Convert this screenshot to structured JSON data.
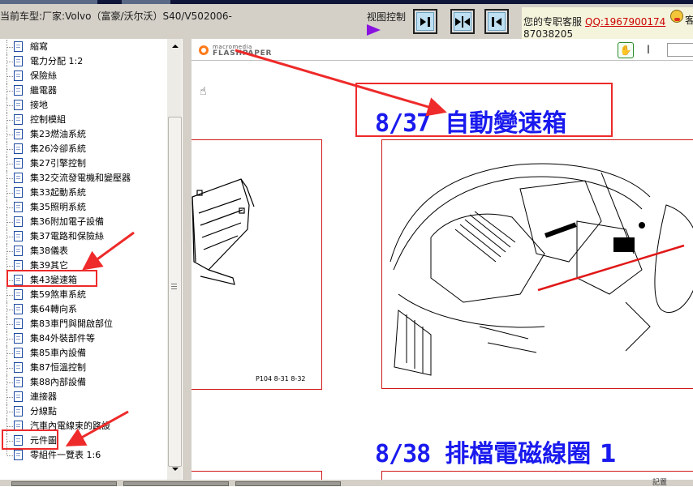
{
  "header": {
    "vehicle_prefix": "当前车型:",
    "vehicle_info": "厂家:Volvo（富豪/沃尔沃）S40/V502006-",
    "view_control_label": "视图控制",
    "support_text": "您的专职客服",
    "support_qq": "QQ:1967900174",
    "support_phone": "87038205",
    "support_tail": "客",
    "buttons": [
      {
        "name": "first-page-icon"
      },
      {
        "name": "split-view-icon"
      },
      {
        "name": "prev-page-icon"
      }
    ]
  },
  "tree": {
    "items": [
      {
        "label": "縮寫"
      },
      {
        "label": "電力分配 1:2"
      },
      {
        "label": "保險絲"
      },
      {
        "label": "繼電器"
      },
      {
        "label": "接地"
      },
      {
        "label": "控制模組"
      },
      {
        "label": "集23燃油系統"
      },
      {
        "label": "集26冷卻系統"
      },
      {
        "label": "集27引擎控制"
      },
      {
        "label": "集32交流發電機和變壓器"
      },
      {
        "label": "集33起動系統"
      },
      {
        "label": "集35照明系統"
      },
      {
        "label": "集36附加電子設備"
      },
      {
        "label": "集37電路和保險絲"
      },
      {
        "label": "集38儀表"
      },
      {
        "label": "集39其它"
      },
      {
        "label": "集43變速箱"
      },
      {
        "label": "集59煞車系統"
      },
      {
        "label": "集64轉向系"
      },
      {
        "label": "集83車門與開啟部位"
      },
      {
        "label": "集84外裝部件等"
      },
      {
        "label": "集85車內設備"
      },
      {
        "label": "集87恒溫控制"
      },
      {
        "label": "集88內部設備"
      },
      {
        "label": "連接器"
      },
      {
        "label": "分線點"
      },
      {
        "label": "汽車內電線束的路設"
      },
      {
        "label": "元件圖"
      },
      {
        "label": "零組件一覽表 1:6"
      }
    ]
  },
  "viewer": {
    "logo_small": "macromedia",
    "logo_big": "FLASHPAPER",
    "hand_tool": "✋",
    "text_tool": "I",
    "page_hand": "☝",
    "heading1_num": "8/37",
    "heading1_title": "自動變速箱",
    "heading2_num": "8/38",
    "heading2_title": "排檔電磁線圈 1",
    "fig_caption": "P104  8-31  8-32"
  },
  "statusbar": {
    "right_text": "記置"
  },
  "colors": {
    "annotation_red": "#ee2a2a",
    "heading_blue": "#1a1aee",
    "frame_red": "#d01818",
    "view_arrow_purple": "#8a12e0",
    "qq_red": "#cc0000"
  }
}
